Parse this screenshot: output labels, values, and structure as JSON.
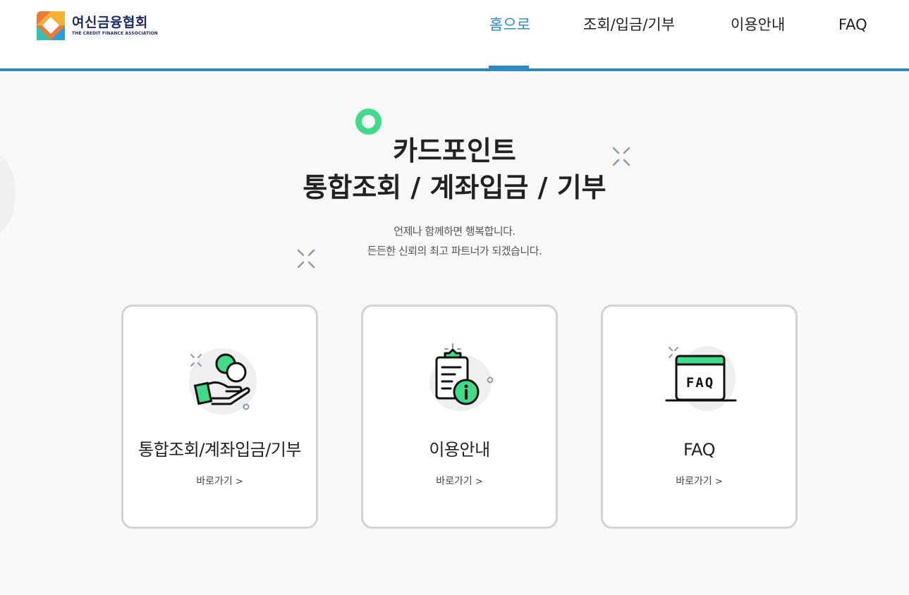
{
  "logo": {
    "name_ko": "여신금융협회",
    "name_en": "THE CREDIT FINANCE ASSOCIATION"
  },
  "nav": {
    "items": [
      {
        "label": "홈으로",
        "active": true
      },
      {
        "label": "조회/입금/기부",
        "active": false
      },
      {
        "label": "이용안내",
        "active": false
      },
      {
        "label": "FAQ",
        "active": false
      }
    ]
  },
  "hero": {
    "title_line1": "카드포인트",
    "title_line2": "통합조회 / 계좌입금 / 기부",
    "subtitle_line1": "언제나 함께하면 행복합니다.",
    "subtitle_line2": "든든한 신뢰의 최고 파트너가 되겠습니다."
  },
  "cards": [
    {
      "title": "통합조회/계좌입금/기부",
      "link": "바로가기",
      "icon": "hand-coin-icon"
    },
    {
      "title": "이용안내",
      "link": "바로가기",
      "icon": "clipboard-info-icon"
    },
    {
      "title": "FAQ",
      "link": "바로가기",
      "icon": "faq-window-icon"
    }
  ],
  "colors": {
    "accent": "#2d89c3",
    "green": "#41d98a",
    "card_border": "#d3d3d3",
    "background": "#f8f8f8"
  }
}
